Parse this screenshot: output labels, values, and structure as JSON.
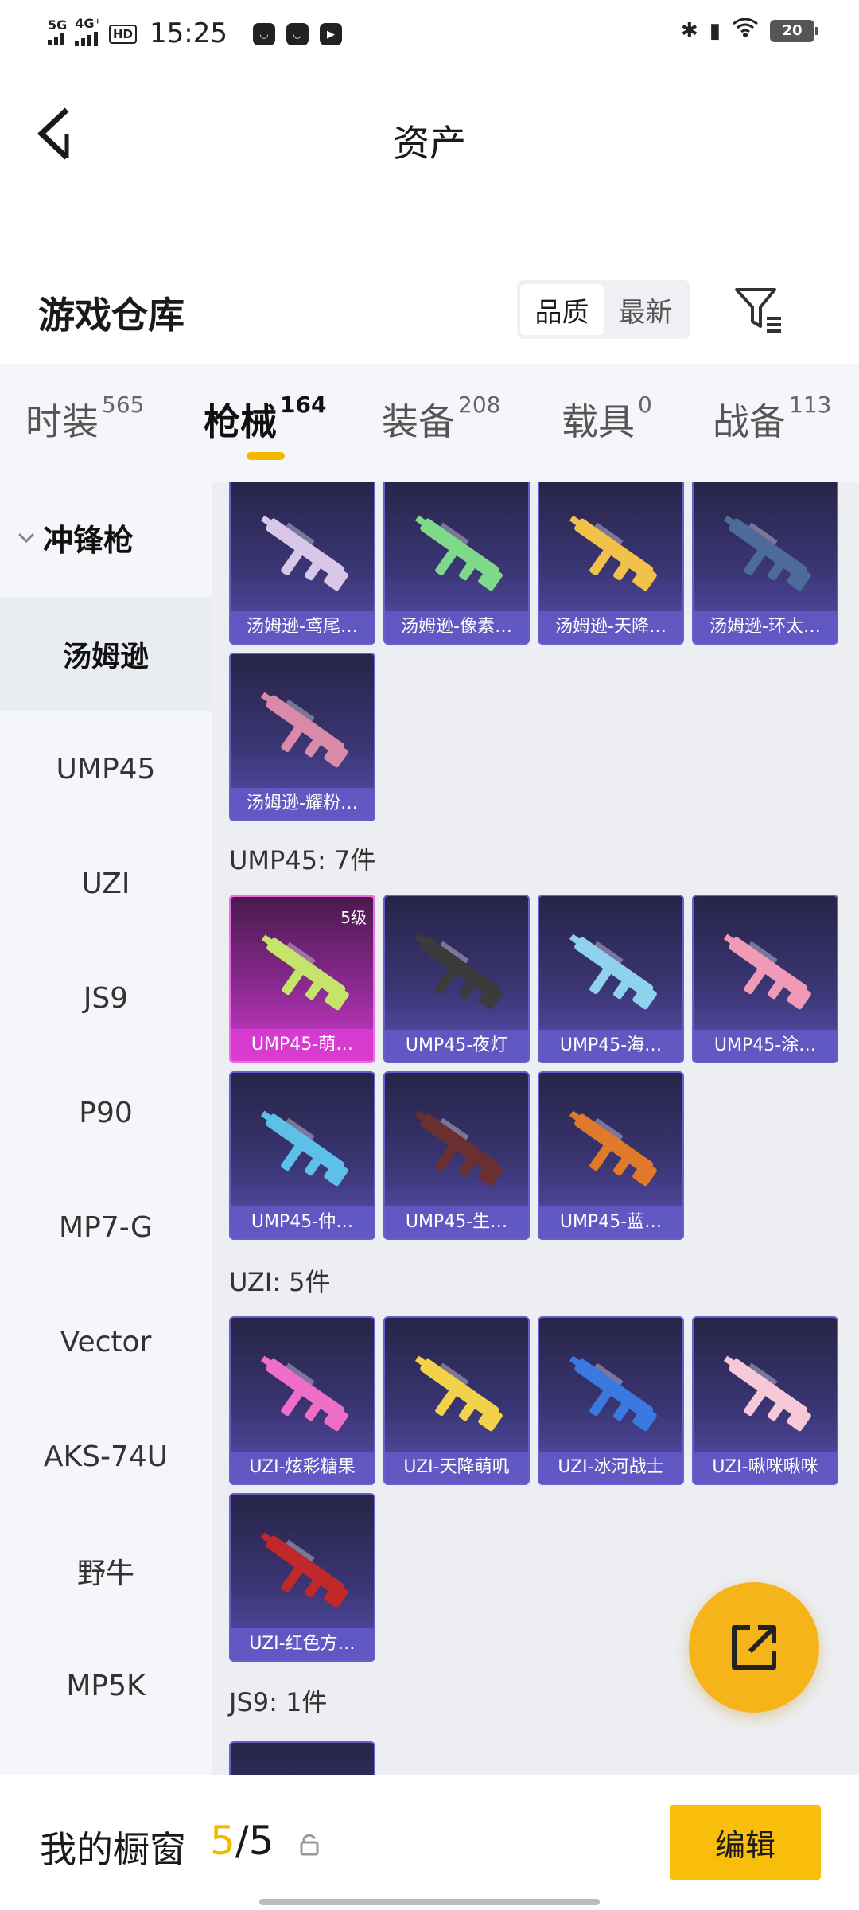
{
  "status_bar": {
    "net1": "5G",
    "net2": "4G⁺",
    "hd": "HD",
    "time": "15:25",
    "battery": "20"
  },
  "nav": {
    "title": "资产"
  },
  "section": {
    "title": "游戏仓库",
    "sort_options": [
      "品质",
      "最新"
    ],
    "active_sort": "品质"
  },
  "tabs": [
    {
      "label": "时装",
      "count": "565"
    },
    {
      "label": "枪械",
      "count": "164"
    },
    {
      "label": "装备",
      "count": "208"
    },
    {
      "label": "载具",
      "count": "0"
    },
    {
      "label": "战备",
      "count": "113"
    }
  ],
  "active_tab": "枪械",
  "sidebar": {
    "group": "冲锋枪",
    "items": [
      "汤姆逊",
      "UMP45",
      "UZI",
      "JS9",
      "P90",
      "MP7-G",
      "Vector",
      "AKS-74U",
      "野牛",
      "MP5K"
    ],
    "active": "汤姆逊"
  },
  "content": {
    "thompson": [
      {
        "name": "汤姆逊-鸢尾…",
        "gun_color": "#d8c7e8"
      },
      {
        "name": "汤姆逊-像素…",
        "gun_color": "#7fd98a"
      },
      {
        "name": "汤姆逊-天降…",
        "gun_color": "#f2c14a"
      },
      {
        "name": "汤姆逊-环太…",
        "gun_color": "#4c6a9a"
      },
      {
        "name": "汤姆逊-耀粉…",
        "gun_color": "#d98aa8"
      }
    ],
    "ump45_label": "UMP45: 7件",
    "ump45": [
      {
        "name": "UMP45-萌…",
        "level": "5级",
        "gun_color": "#c6e36a"
      },
      {
        "name": "UMP45-夜灯",
        "gun_color": "#3c3a3a"
      },
      {
        "name": "UMP45-海…",
        "gun_color": "#8ed2ee"
      },
      {
        "name": "UMP45-涂…",
        "gun_color": "#f09ab8"
      },
      {
        "name": "UMP45-仲…",
        "gun_color": "#5cc0e8"
      },
      {
        "name": "UMP45-生…",
        "gun_color": "#6a3030"
      },
      {
        "name": "UMP45-蓝…",
        "gun_color": "#e07a2a"
      }
    ],
    "uzi_label": "UZI: 5件",
    "uzi": [
      {
        "name": "UZI-炫彩糖果",
        "gun_color": "#ee6ec8"
      },
      {
        "name": "UZI-天降萌叽",
        "gun_color": "#f2d24a"
      },
      {
        "name": "UZI-冰河战士",
        "gun_color": "#3a7ae0"
      },
      {
        "name": "UZI-啾咪啾咪",
        "gun_color": "#f6c8d8"
      },
      {
        "name": "UZI-红色方…",
        "gun_color": "#c0282a"
      }
    ],
    "js9_label": "JS9: 1件"
  },
  "bottom": {
    "showcase_label": "我的橱窗",
    "showcase_current": "5",
    "showcase_total": "/5",
    "edit_label": "编辑"
  },
  "colors": {
    "accent": "#f5b800",
    "card_base": "#3a3573",
    "card_legend": "#d13ad0"
  }
}
